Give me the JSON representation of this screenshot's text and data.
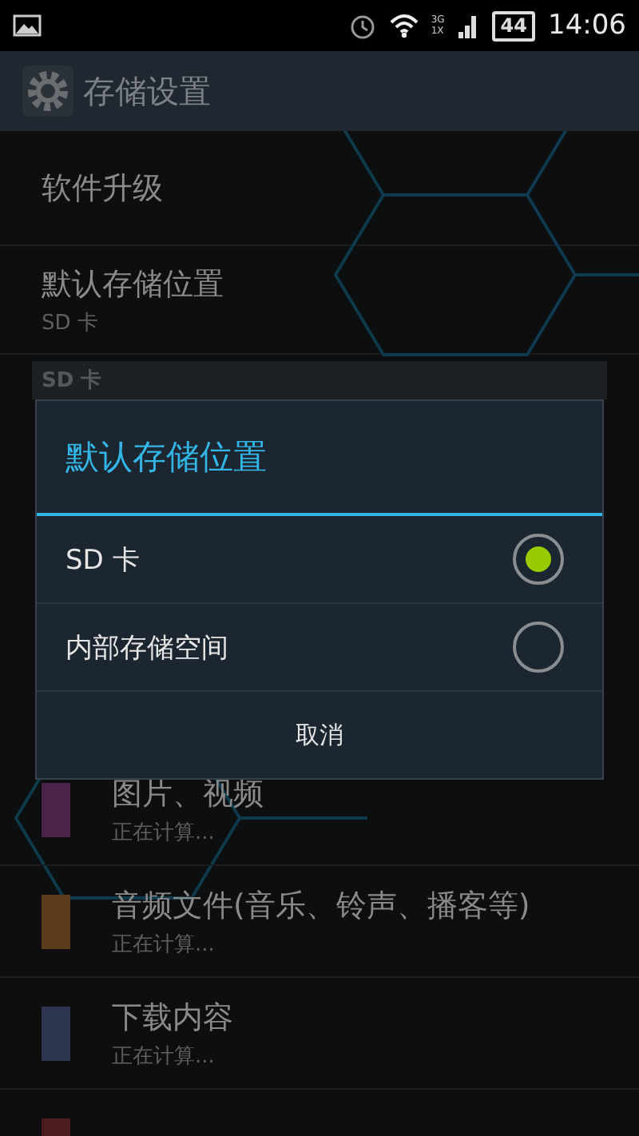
{
  "status_bar": {
    "network_labels": [
      "3G",
      "1X"
    ],
    "battery": "44",
    "time": "14:06"
  },
  "action_bar": {
    "title": "存储设置"
  },
  "settings": [
    {
      "title": "软件升级"
    },
    {
      "title": "默认存储位置",
      "summary": "SD 卡"
    }
  ],
  "section_header": "SD 卡",
  "storage_items": [
    {
      "title": "图片、视频",
      "summary": "正在计算...",
      "color": "#4a2448"
    },
    {
      "title": "音频文件(音乐、铃声、播客等)",
      "summary": "正在计算...",
      "color": "#5a3c1c"
    },
    {
      "title": "下载内容",
      "summary": "正在计算...",
      "color": "#2c3450"
    },
    {
      "color": "#4a1c1c"
    }
  ],
  "dialog": {
    "title": "默认存储位置",
    "options": [
      {
        "label": "SD 卡",
        "selected": true
      },
      {
        "label": "内部存储空间",
        "selected": false
      }
    ],
    "cancel": "取消"
  }
}
